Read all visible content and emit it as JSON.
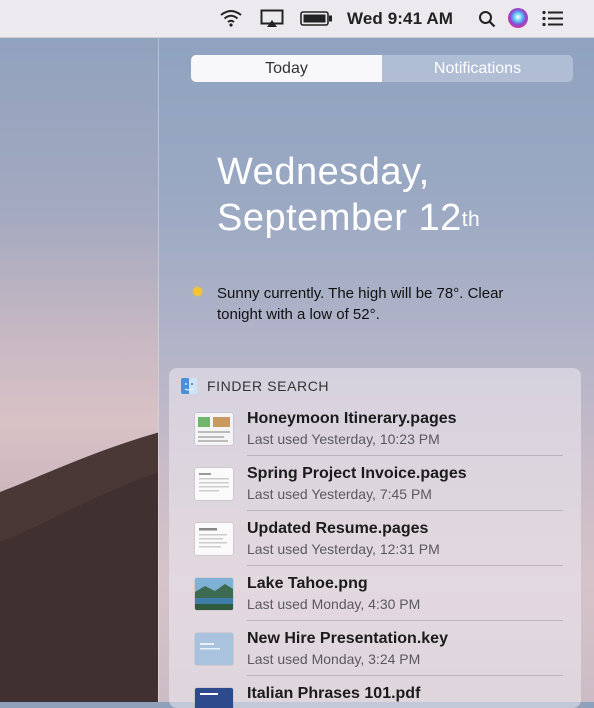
{
  "menubar": {
    "clock": "Wed 9:41 AM",
    "icons": [
      "wifi-icon",
      "airplay-icon",
      "battery-icon",
      "search-icon",
      "siri-icon",
      "notification-center-icon"
    ]
  },
  "tabs": {
    "today": "Today",
    "notifications": "Notifications",
    "selected": "Today"
  },
  "date": {
    "line1": "Wednesday,",
    "line2": "September 12",
    "suffix": "th"
  },
  "weather": {
    "icon": "sun-icon",
    "text": "Sunny currently. The high will be 78°. Clear tonight with a low of 52°."
  },
  "finder_search": {
    "title": "FINDER SEARCH",
    "items": [
      {
        "name": "Honeymoon Itinerary.pages",
        "meta": "Last used Yesterday, 10:23 PM"
      },
      {
        "name": "Spring Project Invoice.pages",
        "meta": "Last used Yesterday, 7:45 PM"
      },
      {
        "name": "Updated Resume.pages",
        "meta": "Last used Yesterday, 12:31 PM"
      },
      {
        "name": "Lake Tahoe.png",
        "meta": "Last used Monday, 4:30 PM"
      },
      {
        "name": "New Hire Presentation.key",
        "meta": "Last used Monday, 3:24 PM"
      },
      {
        "name": "Italian Phrases 101.pdf",
        "meta": ""
      }
    ]
  }
}
